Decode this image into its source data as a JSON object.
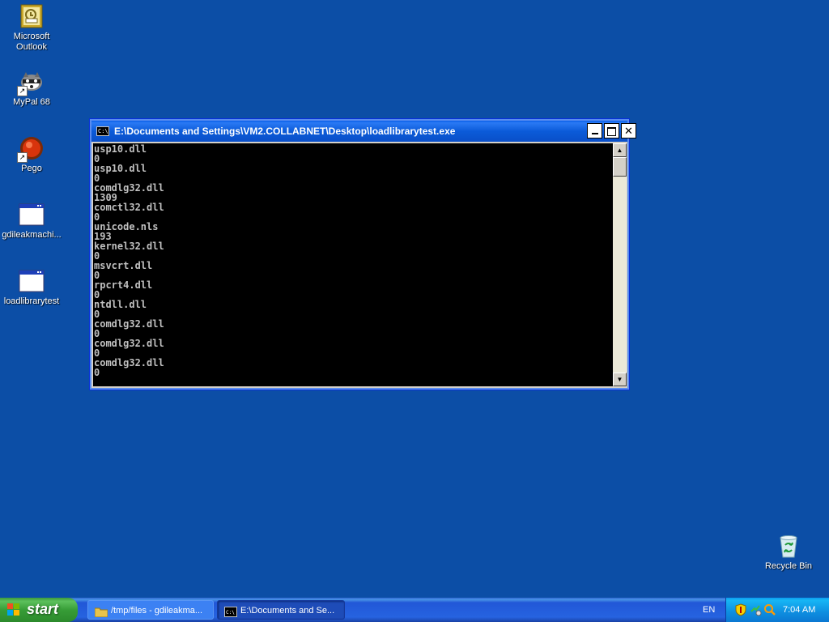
{
  "desktop": {
    "icons": [
      {
        "label": "Microsoft\nOutlook"
      },
      {
        "label": "MyPal 68"
      },
      {
        "label": "Pego"
      },
      {
        "label": "gdileakmachi..."
      },
      {
        "label": "loadlibrarytest"
      },
      {
        "label": "Recycle Bin"
      }
    ]
  },
  "console": {
    "title": "E:\\Documents and Settings\\VM2.COLLABNET\\Desktop\\loadlibrarytest.exe",
    "icon_text": "C:\\",
    "output": "usp10.dll\n0\nusp10.dll\n0\ncomdlg32.dll\n1309\ncomctl32.dll\n0\nunicode.nls\n193\nkernel32.dll\n0\nmsvcrt.dll\n0\nrpcrt4.dll\n0\nntdll.dll\n0\ncomdlg32.dll\n0\ncomdlg32.dll\n0\ncomdlg32.dll\n0",
    "buttons": {
      "minimize": "",
      "maximize": "",
      "close": "✕"
    },
    "scrollbar": {
      "up": "▲",
      "down": "▼"
    }
  },
  "taskbar": {
    "start_label": "start",
    "tasks": [
      {
        "label": "/tmp/files - gdileakma...",
        "icon": "folder-icon"
      },
      {
        "label": "E:\\Documents and Se...",
        "icon": "console-icon"
      }
    ],
    "language": "EN",
    "clock": "7:04 AM"
  },
  "colors": {
    "desktop": "#0c4ea6",
    "titlebar": "#0b5bd9",
    "start": "#379d37",
    "tray": "#0e8ee0"
  }
}
